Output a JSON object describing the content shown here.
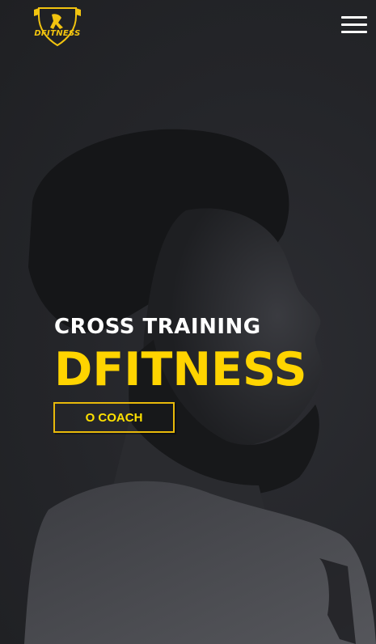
{
  "brand": {
    "logo_text": "DFITNESS",
    "accent_color": "#ffd400"
  },
  "header": {
    "menu_icon": "hamburger-menu-icon"
  },
  "hero": {
    "subtitle": "CROSS TRAINING",
    "title": "DFITNESS",
    "cta_label": "O COACH",
    "background_image": "profile-portrait-of-man-in-grayscale"
  }
}
